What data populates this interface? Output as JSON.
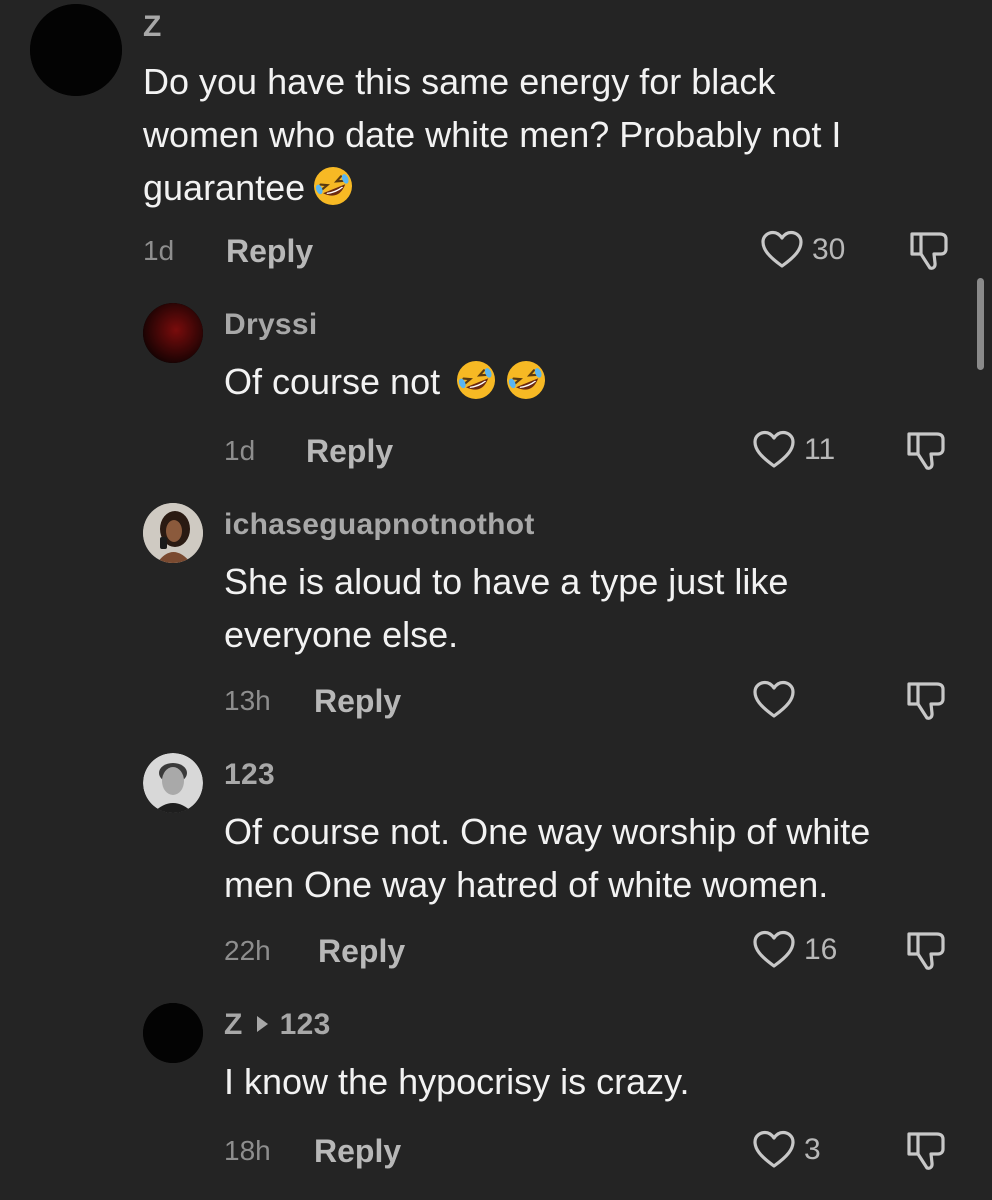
{
  "comments": [
    {
      "username": "Z",
      "text": "Do you have this same energy for black\nwomen who date white men? Probably not I\nguarantee",
      "emoji": "rolling-on-floor-laughing",
      "time": "1d",
      "reply_label": "Reply",
      "likes": "30"
    },
    {
      "username": "Dryssi",
      "text": "Of course not",
      "emoji": "rolling-on-floor-laughing x2",
      "time": "1d",
      "reply_label": "Reply",
      "likes": "11"
    },
    {
      "username": "ichaseguapnotnothot",
      "text": "She is aloud to have a type just like\neveryone else.",
      "time": "13h",
      "reply_label": "Reply",
      "likes": ""
    },
    {
      "username": "123",
      "text": "Of course not. One way worship of white\nmen One way hatred of white women.",
      "time": "22h",
      "reply_label": "Reply",
      "likes": "16"
    },
    {
      "username": "Z",
      "reply_to": "123",
      "text": "I know the hypocrisy is crazy.",
      "time": "18h",
      "reply_label": "Reply",
      "likes": "3"
    }
  ],
  "icons": {
    "like": "heart-outline-icon",
    "dislike": "thumbs-down-outline-icon",
    "emoji": "rolling-on-floor-laughing-emoji"
  },
  "colors": {
    "background": "#242424",
    "text": "#f2f2f2",
    "username": "#a8a8a8",
    "meta": "#8e8e8e"
  }
}
